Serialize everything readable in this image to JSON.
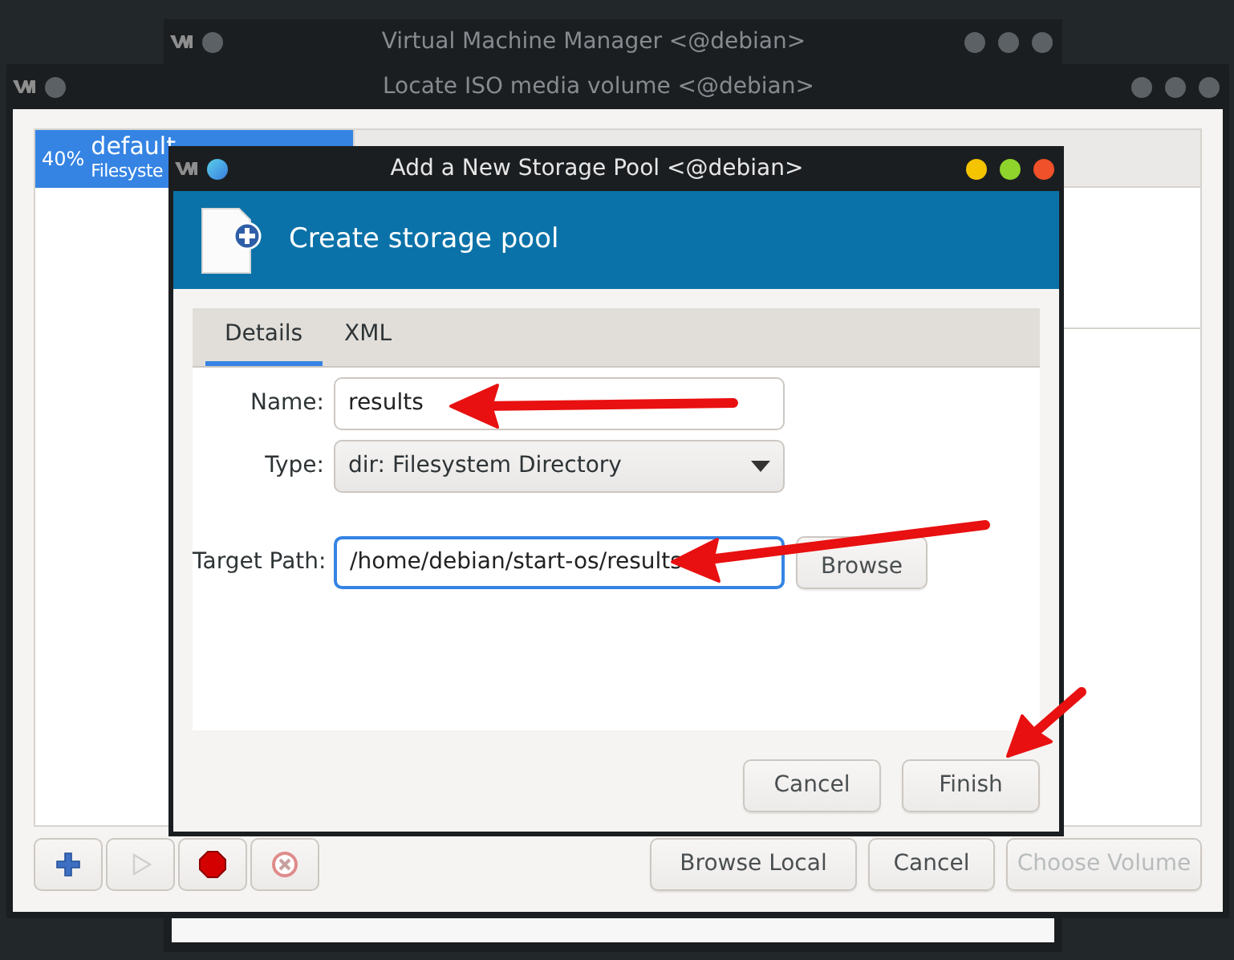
{
  "background_window": {
    "title": "Virtual Machine Manager <@debian>"
  },
  "locate_window": {
    "title": "Locate ISO media volume <@debian>",
    "pools": [
      {
        "usage": "40%",
        "name": "default",
        "type": "Filesyste",
        "selected": true
      }
    ],
    "tool_buttons": [
      {
        "kind": "add",
        "disabled": false
      },
      {
        "kind": "start",
        "disabled": true
      },
      {
        "kind": "stop",
        "disabled": false
      },
      {
        "kind": "delete",
        "disabled": false
      }
    ],
    "buttons": [
      {
        "label": "Browse Local",
        "disabled": false
      },
      {
        "label": "Cancel",
        "disabled": false
      },
      {
        "label": "Choose Volume",
        "disabled": true
      }
    ]
  },
  "dialog": {
    "title": "Add a New Storage Pool <@debian>",
    "header": "Create storage pool",
    "tabs": [
      {
        "label": "Details",
        "selected": true
      },
      {
        "label": "XML",
        "selected": false
      }
    ],
    "fields": [
      {
        "kind": "text",
        "label": "Name:",
        "value": "results",
        "focused": false
      },
      {
        "kind": "combo",
        "label": "Type:",
        "value": "dir: Filesystem Directory",
        "focused": false
      },
      {
        "kind": "path",
        "label": "Target Path:",
        "value": "/home/debian/start-os/results",
        "focused": true,
        "button": "Browse"
      }
    ],
    "buttons": [
      {
        "label": "Cancel"
      },
      {
        "label": "Finish"
      }
    ]
  }
}
